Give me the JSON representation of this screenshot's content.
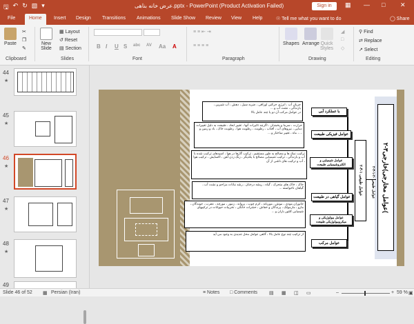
{
  "window": {
    "title": "عرض خانه بناهی.pptx - PowerPoint (Product Activation Failed)",
    "signin": "Sign in"
  },
  "tabs": [
    {
      "label": "File"
    },
    {
      "label": "Home"
    },
    {
      "label": "Insert"
    },
    {
      "label": "Design"
    },
    {
      "label": "Transitions"
    },
    {
      "label": "Animations"
    },
    {
      "label": "Slide Show"
    },
    {
      "label": "Review"
    },
    {
      "label": "View"
    },
    {
      "label": "Help"
    }
  ],
  "tell_me": "Tell me what you want to do",
  "share": "Share",
  "ribbon": {
    "paste": "Paste",
    "clipboard": "Clipboard",
    "new_slide_1": "New",
    "new_slide_2": "Slide",
    "layout": "Layout",
    "reset": "Reset",
    "section": "Section",
    "slides": "Slides",
    "font": "Font",
    "paragraph": "Paragraph",
    "shapes": "Shapes",
    "arrange": "Arrange",
    "quick_styles_1": "Quick",
    "quick_styles_2": "Styles",
    "drawing": "Drawing",
    "find": "Find",
    "replace": "Replace",
    "select": "Select",
    "editing": "Editing",
    "fmt": [
      "B",
      "I",
      "U",
      "S",
      "abc",
      "AV",
      "Aa",
      "A"
    ]
  },
  "thumbs": [
    {
      "num": "44"
    },
    {
      "num": "45"
    },
    {
      "num": "46"
    },
    {
      "num": "47"
    },
    {
      "num": "48"
    },
    {
      "num": "49"
    }
  ],
  "slide": {
    "main_title": "۲-۳عوامل مخارجی)خارجی(",
    "mid_label": "۲-۳-۱ عوامل طبیعی",
    "side_label": "۲-۳-۱-۲- عوامل طبیعی",
    "labels": [
      "با عملکرد آبی",
      "عوامل فیزیکی طبیعت",
      "عوامل شیمیایی و الکتروشیمیایی طبیعت",
      "عوامل گیاهی در طبیعت",
      "عوامل بیولوژیکی و میکروبیولوژیکی طبیعت",
      "عوامل مرکب"
    ],
    "texts": [
      "جریان آب ، انرژی حرکتی اوراقی ، ضربه سیل ، دهش ، آب شیرین ، بارندگی ، نشت آب و ...",
      "در عوامل مرکب آن دو یا چند عامل بالا",
      "حرارت ، سرما و یخبندان ، اگرچه تاثیرات آنها ، تغییر ابعاد ، طبیعت به دلیل تغییرات دمایی ، نیروهای آب ، آفتاب ، رطوبت ، رطوبت هوا ، رطوبت خاک ، باد و زمین و ... ، ماه ، تغییر ساختار و ...",
      "ترکیب نمک ها و مصالح به طور مستقیم ، ترکیب گازها در هوا ، اسیدهای ترکیب شده با آب و بارندگی ، ترکیب شیمیایی مصالح با یکدیگر ، زنگ زدن آهن ، اکسایش ، ترکیب هوا ، آب و ترکیب های ناشی از آن",
      "خاک ، خاک های متحرک ، گیاه ، ریشه درختان ، رشد نباتات مزاحم و نشت آب ، گیاهان ناخواسته ...",
      "جانوران موذی ، موش ، موریانه ، کرم چوب ، پروانه ، زنبور ، مورچه ، عقرب ، جوندگان ، مارو ، مارمولک ، پرندگان و خفاش ، حشرات خانگی ، تخریبات حیوانات در ترکیبهای شیمیایی کلتور باران و ...",
      "از ترکیب چند نوع عامل بالا ، گاهی عوامل محل جدیدی به وجود می آید"
    ]
  },
  "status": {
    "slide": "Slide 46 of 52",
    "language": "Persian (Iran)",
    "notes": "Notes",
    "comments": "Comments",
    "zoom": "59 %"
  }
}
